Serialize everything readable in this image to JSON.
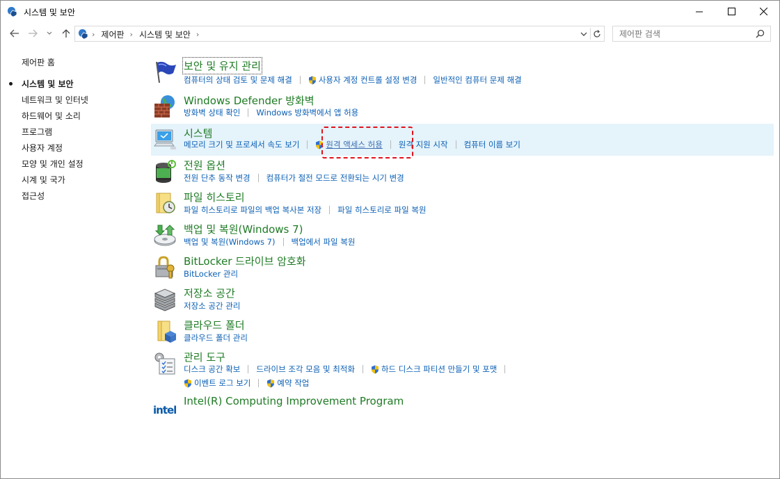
{
  "window": {
    "title": "시스템 및 보안"
  },
  "nav": {
    "breadcrumbs": [
      "제어판",
      "시스템 및 보안"
    ],
    "search_placeholder": "제어판 검색"
  },
  "sidebar": {
    "items": [
      {
        "label": "제어판 홈",
        "active": false
      },
      {
        "label": "시스템 및 보안",
        "active": true
      },
      {
        "label": "네트워크 및 인터넷",
        "active": false
      },
      {
        "label": "하드웨어 및 소리",
        "active": false
      },
      {
        "label": "프로그램",
        "active": false
      },
      {
        "label": "사용자 계정",
        "active": false
      },
      {
        "label": "모양 및 개인 설정",
        "active": false
      },
      {
        "label": "시계 및 국가",
        "active": false
      },
      {
        "label": "접근성",
        "active": false
      }
    ]
  },
  "categories": {
    "security": {
      "title": "보안 및 유지 관리",
      "links": [
        "컴퓨터의 상태 검토 및 문제 해결",
        "사용자 계정 컨트롤 설정 변경",
        "일반적인 컴퓨터 문제 해결"
      ]
    },
    "firewall": {
      "title": "Windows Defender 방화벽",
      "links": [
        "방화벽 상태 확인",
        "Windows 방화벽에서 앱 허용"
      ]
    },
    "system": {
      "title": "시스템",
      "links": [
        "메모리 크기 및 프로세서 속도 보기",
        "원격 액세스 허용",
        "원격 지원 시작",
        "컴퓨터 이름 보기"
      ]
    },
    "power": {
      "title": "전원 옵션",
      "links": [
        "전원 단추 동작 변경",
        "컴퓨터가 절전 모드로 전환되는 시기 변경"
      ]
    },
    "filehistory": {
      "title": "파일 히스토리",
      "links": [
        "파일 히스토리로 파일의 백업 복사본 저장",
        "파일 히스토리로 파일 복원"
      ]
    },
    "backup": {
      "title": "백업 및 복원(Windows 7)",
      "links": [
        "백업 및 복원(Windows 7)",
        "백업에서 파일 복원"
      ]
    },
    "bitlocker": {
      "title": "BitLocker 드라이브 암호화",
      "links": [
        "BitLocker 관리"
      ]
    },
    "storage": {
      "title": "저장소 공간",
      "links": [
        "저장소 공간 관리"
      ]
    },
    "cloud": {
      "title": "클라우드 폴더",
      "links": [
        "클라우드 폴더 관리"
      ]
    },
    "admin": {
      "title": "관리 도구",
      "links": [
        "디스크 공간 확보",
        "드라이브 조각 모음 및 최적화",
        "하드 디스크 파티션 만들기 및 포맷",
        "이벤트 로그 보기",
        "예약 작업"
      ]
    },
    "intel": {
      "title": "Intel(R) Computing Improvement Program",
      "logo_text": "intel"
    }
  },
  "colors": {
    "category_title": "#1e7b24",
    "link": "#0b5fb4",
    "highlight_bg": "#e5f3fb",
    "focus_box": "#e0121d"
  }
}
